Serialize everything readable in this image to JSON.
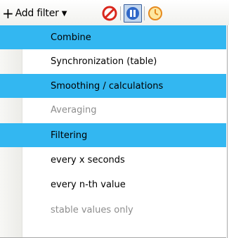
{
  "toolbar": {
    "add_filter_label": "Add filter",
    "icons": [
      "plus-icon",
      "chevron-down-icon",
      "no-entry-icon",
      "pause-icon",
      "clock-icon"
    ]
  },
  "menu": {
    "items": [
      {
        "label": "Combine",
        "type": "header"
      },
      {
        "label": "Synchronization (table)",
        "type": "item"
      },
      {
        "label": "Smoothing / calculations",
        "type": "header"
      },
      {
        "label": "Averaging",
        "type": "disabled"
      },
      {
        "label": "Filtering",
        "type": "header"
      },
      {
        "label": "every x seconds",
        "type": "item"
      },
      {
        "label": "every n-th value",
        "type": "item"
      },
      {
        "label": "stable values only",
        "type": "disabled"
      }
    ]
  },
  "colors": {
    "highlight": "#33b7f1",
    "disabled_text": "#8d8d8d",
    "stop": "#d9261c",
    "pause_border": "#3a5f9a"
  }
}
